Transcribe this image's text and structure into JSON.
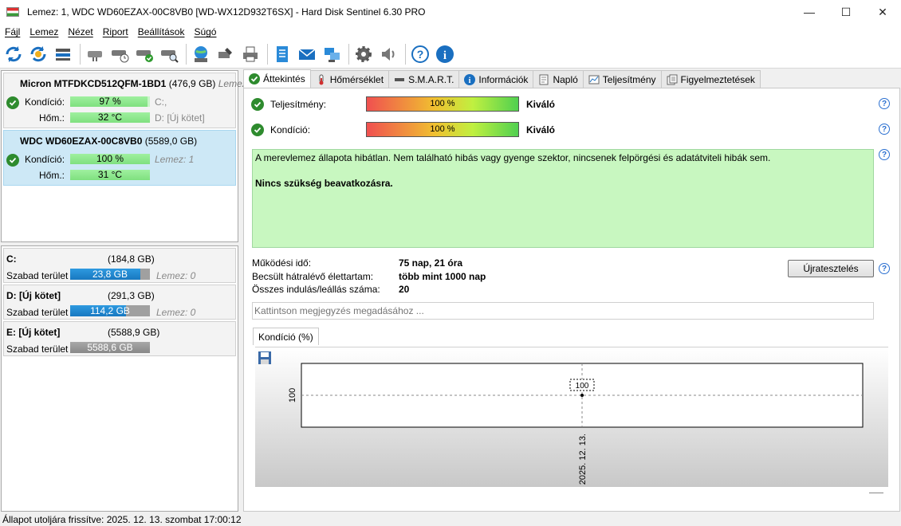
{
  "window": {
    "title": "Lemez: 1, WDC WD60EZAX-00C8VB0 [WD-WX12D932T6SX]  -  Hard Disk Sentinel 6.30 PRO",
    "controls": {
      "minimize": "—",
      "maximize": "☐",
      "close": "✕"
    }
  },
  "menu": [
    "Fájl",
    "Lemez",
    "Nézet",
    "Riport",
    "Beállítások",
    "Súgó"
  ],
  "toolbar": {
    "icons": [
      "refresh-icon",
      "refresh-all-icon",
      "disk-list-icon",
      "disk-icon",
      "disk-time-icon",
      "disk-check-icon",
      "disk-search-icon",
      "network-icon",
      "tools-icon",
      "print-icon",
      "report-icon",
      "email-icon",
      "send-icon",
      "settings-icon",
      "sound-icon",
      "help-icon",
      "info-icon"
    ]
  },
  "disks": [
    {
      "name": "Micron MTFDKCD512QFM-1BD1",
      "size": "(476,9 GB)",
      "extra": "Lemez",
      "condition_label": "Kondíció:",
      "condition": "97 %",
      "condition_pct": 97,
      "temp_label": "Hőm.:",
      "temp": "32 °C",
      "temp_pct": 100,
      "note1": "C:,",
      "note2": "D: [Új kötet]"
    },
    {
      "name": "WDC WD60EZAX-00C8VB0",
      "size": "(5589,0 GB)",
      "extra": "",
      "condition_label": "Kondíció:",
      "condition": "100 %",
      "condition_pct": 100,
      "temp_label": "Hőm.:",
      "temp": "31 °C",
      "temp_pct": 100,
      "note1": "Lemez: 1",
      "note2": ""
    }
  ],
  "volumes": [
    {
      "name": "C:",
      "size": "(184,8 GB)",
      "free_label": "Szabad terület",
      "free": "23,8 GB",
      "free_pct": 88,
      "color": "blue",
      "disk": "Lemez: 0"
    },
    {
      "name": "D: [Új kötet]",
      "size": "(291,3 GB)",
      "free_label": "Szabad terület",
      "free": "114,2 GB",
      "free_pct": 70,
      "color": "blue",
      "disk": "Lemez: 0"
    },
    {
      "name": "E: [Új kötet]",
      "size": "(5588,9 GB)",
      "free_label": "Szabad terület",
      "free": "5588,6 GB",
      "free_pct": 100,
      "color": "gray",
      "disk": ""
    }
  ],
  "tabs": [
    {
      "label": "Áttekintés",
      "icon": "check-icon",
      "active": true
    },
    {
      "label": "Hőmérséklet",
      "icon": "thermometer-icon",
      "active": false
    },
    {
      "label": "S.M.A.R.T.",
      "icon": "disk-icon",
      "active": false
    },
    {
      "label": "Információk",
      "icon": "info-icon",
      "active": false
    },
    {
      "label": "Napló",
      "icon": "log-icon",
      "active": false
    },
    {
      "label": "Teljesítmény",
      "icon": "performance-icon",
      "active": false
    },
    {
      "label": "Figyelmeztetések",
      "icon": "alerts-icon",
      "active": false
    }
  ],
  "overview": {
    "performance_label": "Teljesítmény:",
    "performance_value": "100 %",
    "performance_pct": 100,
    "performance_text": "Kiváló",
    "condition_label": "Kondíció:",
    "condition_value": "100 %",
    "condition_pct": 100,
    "condition_text": "Kiváló",
    "status_text": "A merevlemez állapota hibátlan. Nem található hibás vagy gyenge szektor, nincsenek felpörgési és adatátviteli hibák sem.",
    "status_action": "Nincs szükség beavatkozásra.",
    "uptime_label": "Működési idő:",
    "uptime": "75 nap, 21 óra",
    "lifetime_label": "Becsült hátralévő élettartam:",
    "lifetime": "több mint 1000 nap",
    "startstop_label": "Összes indulás/leállás száma:",
    "startstop": "20",
    "retest_button": "Újratesztelés",
    "note_placeholder": "Kattintson megjegyzés megadásához ...",
    "help": "?"
  },
  "chart_tab": "Kondíció  (%)",
  "chart_data": {
    "type": "line",
    "x": [
      "2025. 12. 13."
    ],
    "series": [
      {
        "values": [
          100
        ]
      }
    ],
    "yticks": [
      "100"
    ],
    "data_labels": [
      "100"
    ]
  },
  "status_bar": "Állapot utoljára frissítve: 2025. 12. 13. szombat 17:00:12"
}
